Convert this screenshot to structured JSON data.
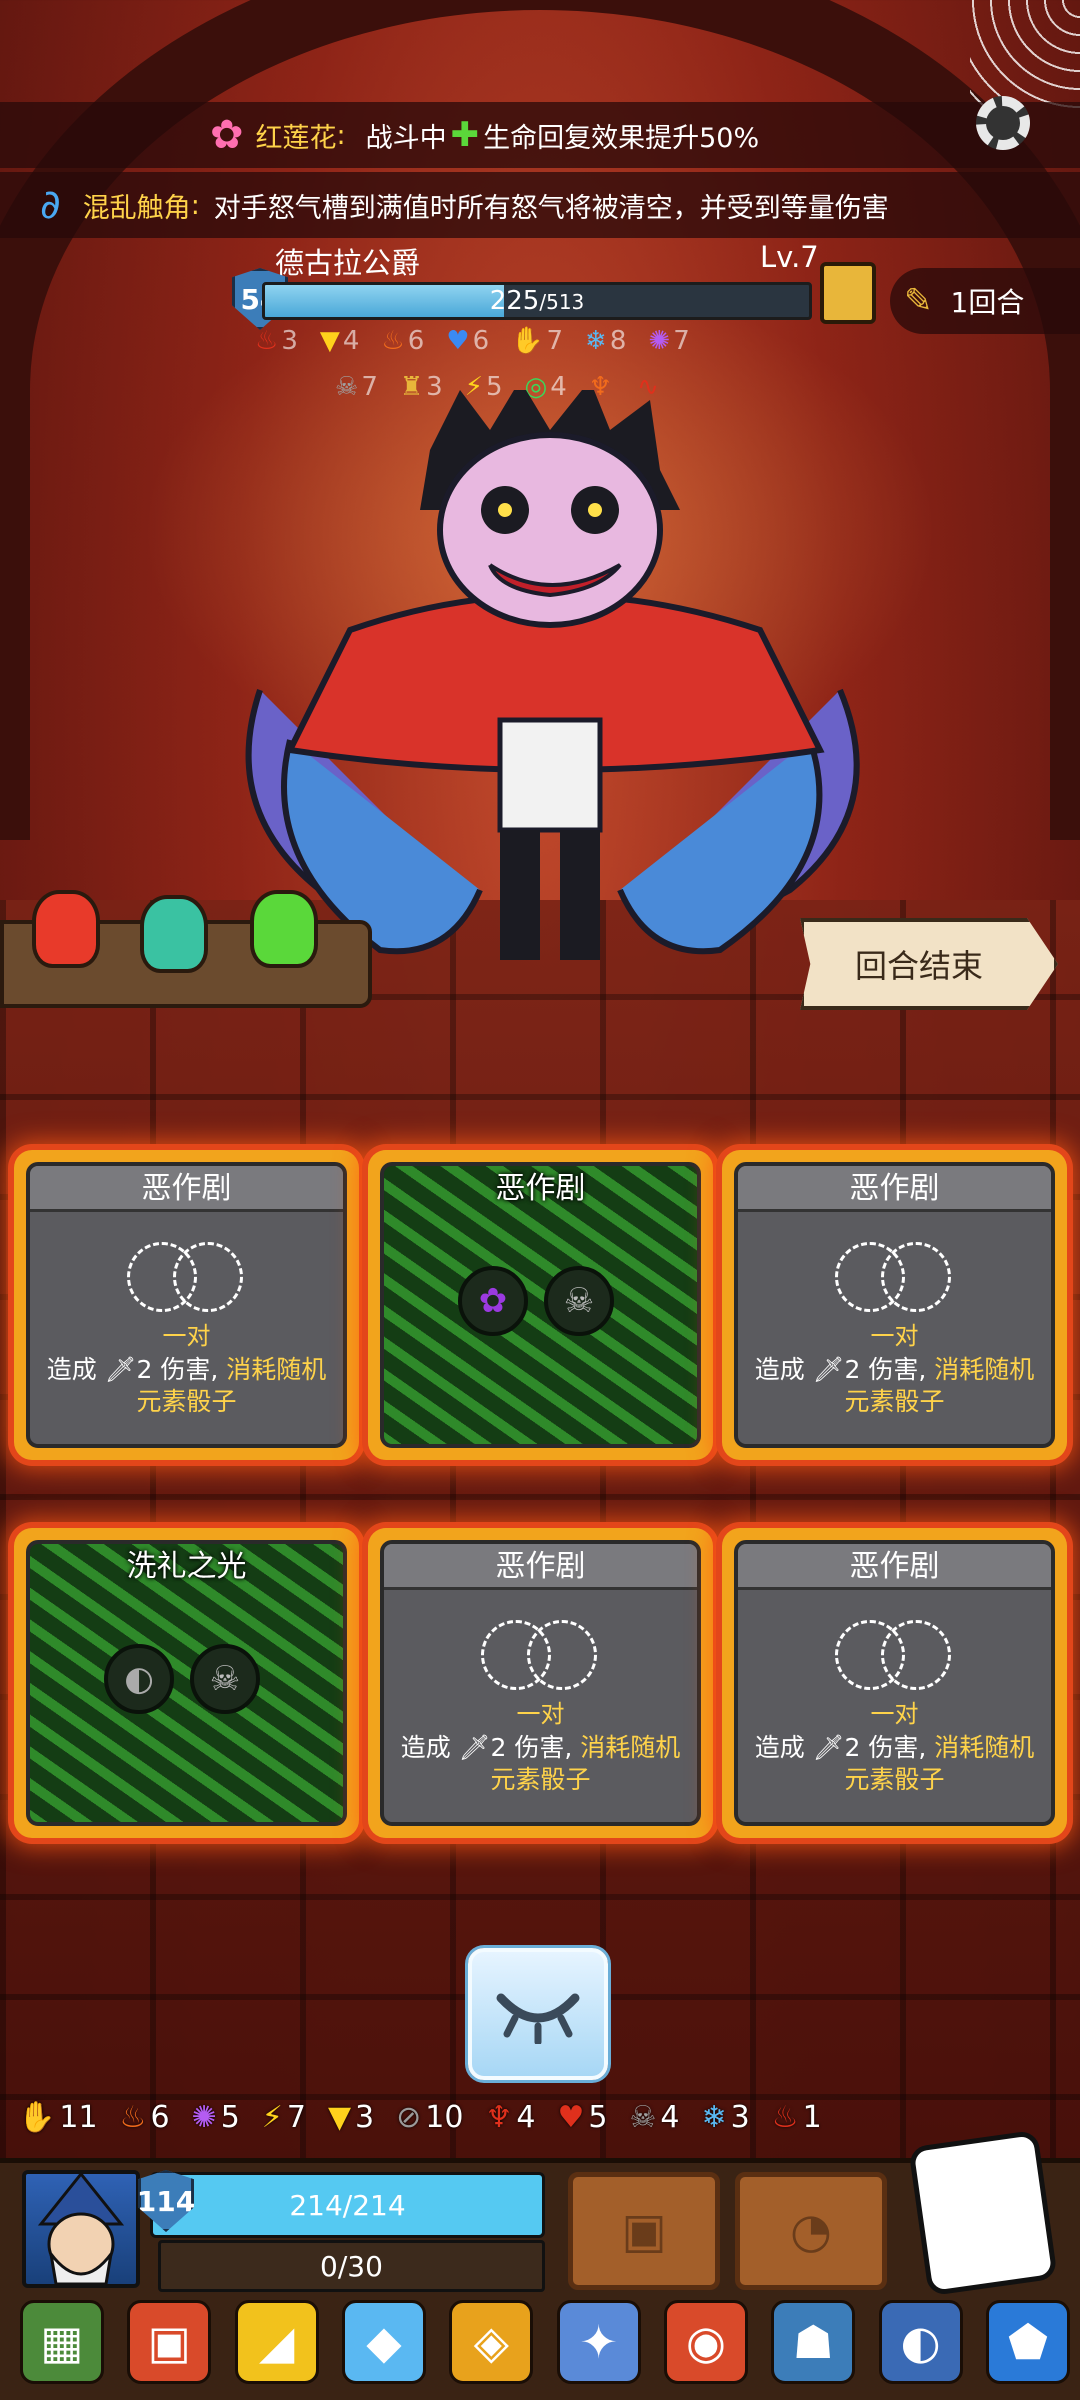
{
  "top_banner": {
    "flower_name": "红莲花",
    "colon": ":",
    "state": "战斗中",
    "effect": "生命回复效果提升50%"
  },
  "second_banner": {
    "name": "混乱触角",
    "colon": ":",
    "text": "对手怒气槽到满值时所有怒气将被清空，并受到等量伤害"
  },
  "boss": {
    "name": "德古拉公爵",
    "level": "Lv.7",
    "shield": "54",
    "hp_current": 225,
    "hp_max": 513,
    "hp_text_current": "225",
    "hp_text_max": "/513",
    "round": "1回合",
    "status_row1": [
      {
        "icon": "fire-icon",
        "value": "3"
      },
      {
        "icon": "triangle-icon",
        "value": "4"
      },
      {
        "icon": "flame-icon",
        "value": "6"
      },
      {
        "icon": "drop-icon",
        "value": "6"
      },
      {
        "icon": "claw-icon",
        "value": "7"
      },
      {
        "icon": "snowflake-icon",
        "value": "8"
      },
      {
        "icon": "splat-icon",
        "value": "7"
      }
    ],
    "status_row2": [
      {
        "icon": "skull-icon",
        "value": "7"
      },
      {
        "icon": "lock-icon",
        "value": "3"
      },
      {
        "icon": "lightning-icon",
        "value": "5"
      },
      {
        "icon": "poison-icon",
        "value": "4"
      },
      {
        "icon": "fang-icon",
        "value": ""
      },
      {
        "icon": "wave-icon",
        "value": ""
      }
    ],
    "colors": {
      "hp_fill": "#4aa8d8",
      "shield": "#3c7db9"
    }
  },
  "end_turn": "回合结束",
  "cards": [
    {
      "title": "恶作剧",
      "type": "pair",
      "pair_label": "一对",
      "desc_prefix": "造成",
      "damage_icon": "🗡",
      "desc_damage": "2 伤害,",
      "desc_yellow1": "消耗随机",
      "desc_yellow2": "元素骰子"
    },
    {
      "title": "恶作剧",
      "type": "vines",
      "slots": [
        "grape-die",
        "skull-die"
      ]
    },
    {
      "title": "恶作剧",
      "type": "pair",
      "pair_label": "一对",
      "desc_prefix": "造成",
      "damage_icon": "🗡",
      "desc_damage": "2 伤害,",
      "desc_yellow1": "消耗随机",
      "desc_yellow2": "元素骰子"
    },
    {
      "title": "洗礼之光",
      "type": "vines",
      "slots": [
        "gray-die",
        "skull-die"
      ]
    },
    {
      "title": "恶作剧",
      "type": "pair",
      "pair_label": "一对",
      "desc_prefix": "造成",
      "damage_icon": "🗡",
      "desc_damage": "2 伤害,",
      "desc_yellow1": "消耗随机",
      "desc_yellow2": "元素骰子"
    },
    {
      "title": "恶作剧",
      "type": "pair",
      "pair_label": "一对",
      "desc_prefix": "造成",
      "damage_icon": "🗡",
      "desc_damage": "2 伤害,",
      "desc_yellow1": "消耗随机",
      "desc_yellow2": "元素骰子"
    }
  ],
  "player_counts": [
    {
      "icon": "claw-icon",
      "glyph": "✋",
      "color": "#f2a21c",
      "value": "11"
    },
    {
      "icon": "flame-icon",
      "glyph": "♨",
      "color": "#f26b1c",
      "value": "6"
    },
    {
      "icon": "splat-icon",
      "glyph": "✺",
      "color": "#b45cf2",
      "value": "5"
    },
    {
      "icon": "lightning-icon",
      "glyph": "⚡",
      "color": "#ffd21c",
      "value": "7"
    },
    {
      "icon": "triangle-icon",
      "glyph": "▼",
      "color": "#ffd21c",
      "value": "3"
    },
    {
      "icon": "slash-icon",
      "glyph": "⊘",
      "color": "#9a9a9a",
      "value": "10"
    },
    {
      "icon": "fang-icon",
      "glyph": "♆",
      "color": "#e0301c",
      "value": "4"
    },
    {
      "icon": "drop-icon",
      "glyph": "♥",
      "color": "#e0301c",
      "value": "5"
    },
    {
      "icon": "skull-icon",
      "glyph": "☠",
      "color": "#a0a0a0",
      "value": "4"
    },
    {
      "icon": "snowflake-icon",
      "glyph": "❄",
      "color": "#5ab8f2",
      "value": "3"
    },
    {
      "icon": "fire-icon",
      "glyph": "♨",
      "color": "#e0301c",
      "value": "1"
    }
  ],
  "player": {
    "shield": "114",
    "hp_text": "214/214",
    "exp_text": "0/30"
  },
  "inventory": [
    {
      "icon": "spellbook-icon",
      "glyph": "▦",
      "bg": "#4c8a3a"
    },
    {
      "icon": "dice-box-icon",
      "glyph": "▣",
      "bg": "#d94a2a"
    },
    {
      "icon": "cheese-icon",
      "glyph": "◢",
      "bg": "#f2c21c"
    },
    {
      "icon": "crystal-icon",
      "glyph": "◆",
      "bg": "#5ab8f2"
    },
    {
      "icon": "amulet-icon",
      "glyph": "◈",
      "bg": "#e8a21c"
    },
    {
      "icon": "claw-weapon-icon",
      "glyph": "✦",
      "bg": "#5a8ad8"
    },
    {
      "icon": "gem-ring-icon",
      "glyph": "◉",
      "bg": "#d94a2a"
    },
    {
      "icon": "demon-mask-icon",
      "glyph": "☗",
      "bg": "#3c7db9"
    },
    {
      "icon": "palette-icon",
      "glyph": "◐",
      "bg": "#3a6ab5"
    },
    {
      "icon": "blue-gem-icon",
      "glyph": "⬟",
      "bg": "#2a7ad8"
    }
  ]
}
